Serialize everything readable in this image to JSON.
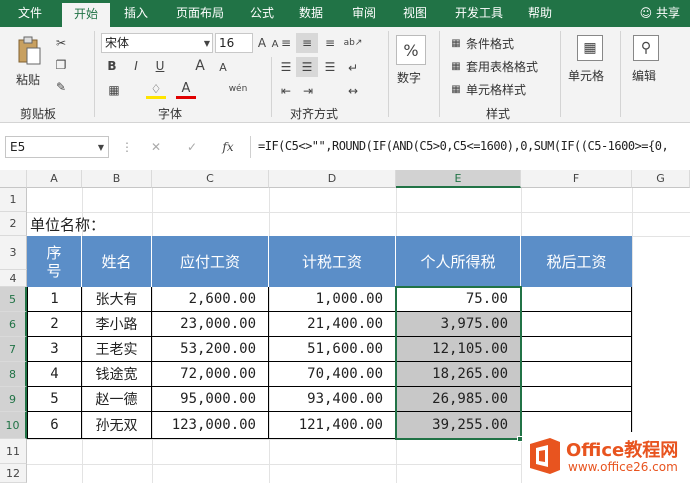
{
  "tabs": [
    "文件",
    "开始",
    "插入",
    "页面布局",
    "公式",
    "数据",
    "审阅",
    "视图",
    "开发工具",
    "帮助"
  ],
  "share_label": "共享",
  "ribbon": {
    "paste_label": "粘贴",
    "clipboard_label": "剪贴板",
    "font_name": "宋体",
    "font_size": "16",
    "font_group_label": "字体",
    "align_group_label": "对齐方式",
    "number_label": "数字",
    "conditional_format": "条件格式",
    "table_format": "套用表格格式",
    "cell_style": "单元格样式",
    "styles_group_label": "样式",
    "cells_label": "单元格",
    "editing_label": "编辑",
    "percent_icon": "%",
    "bold": "B",
    "italic": "I",
    "underline": "U",
    "grow_font": "A",
    "shrink_font": "A",
    "font_color": "A",
    "wen": "wén"
  },
  "formula_bar": {
    "name_box": "E5",
    "fx": "fx",
    "formula": "=IF(C5<>\"\",ROUND(IF(AND(C5>0,C5<=1600),0,SUM(IF((C5-1600>={0,"
  },
  "sheet": {
    "columns": [
      "A",
      "B",
      "C",
      "D",
      "E",
      "F",
      "G"
    ],
    "rows": [
      "1",
      "2",
      "3",
      "4",
      "5",
      "6",
      "7",
      "8",
      "9",
      "10",
      "11",
      "12"
    ],
    "unit_label": "单位名称：",
    "headers": [
      "序\n号",
      "姓名",
      "应付工资",
      "计税工资",
      "个人所得税",
      "税后工资"
    ],
    "data": [
      [
        "1",
        "张大有",
        "2,600.00",
        "1,000.00",
        "75.00",
        ""
      ],
      [
        "2",
        "李小路",
        "23,000.00",
        "21,400.00",
        "3,975.00",
        ""
      ],
      [
        "3",
        "王老实",
        "53,200.00",
        "51,600.00",
        "12,105.00",
        ""
      ],
      [
        "4",
        "钱途宽",
        "72,000.00",
        "70,400.00",
        "18,265.00",
        ""
      ],
      [
        "5",
        "赵一德",
        "95,000.00",
        "93,400.00",
        "26,985.00",
        ""
      ],
      [
        "6",
        "孙无双",
        "123,000.00",
        "121,400.00",
        "39,255.00",
        ""
      ]
    ]
  },
  "watermark": {
    "brand": "Office教程网",
    "url": "www.office26.com"
  }
}
